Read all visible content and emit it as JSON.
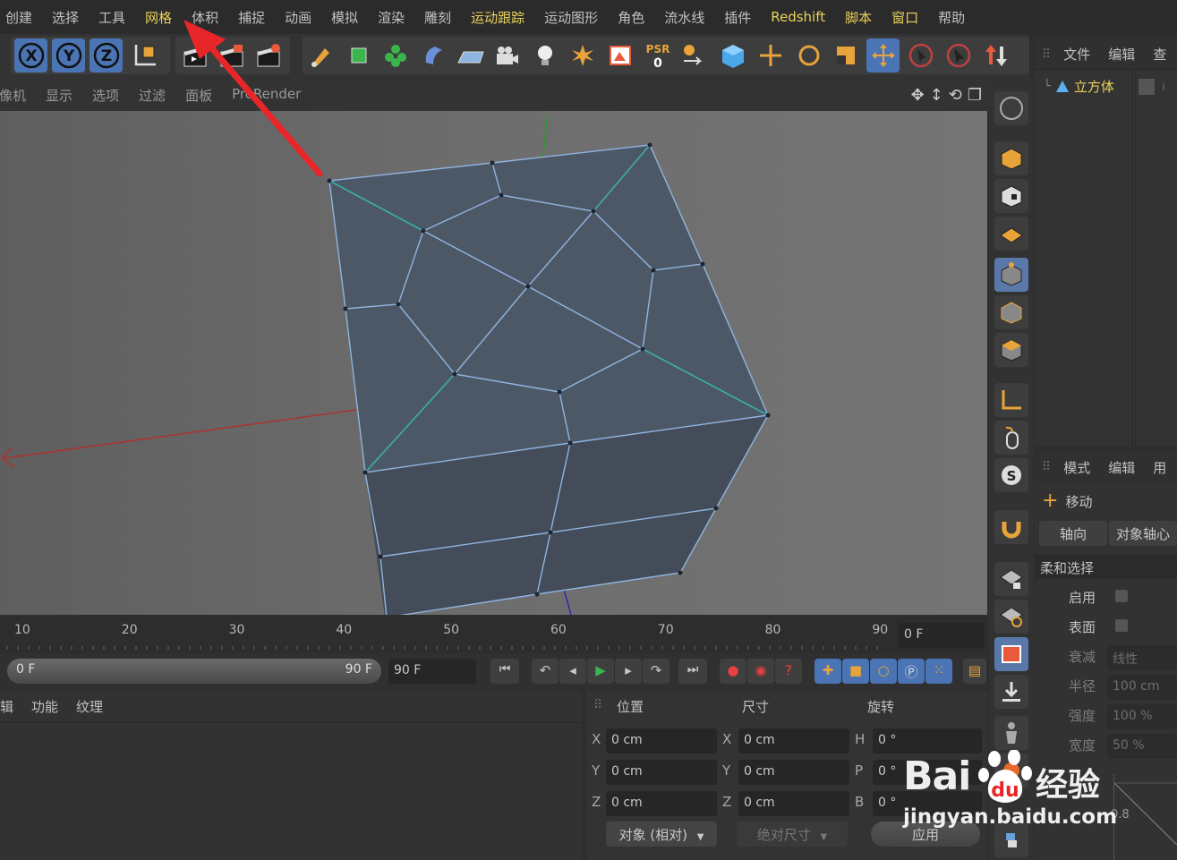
{
  "menubar": {
    "items": [
      "创建",
      "选择",
      "工具",
      "网格",
      "体积",
      "捕捉",
      "动画",
      "模拟",
      "渲染",
      "雕刻",
      "运动跟踪",
      "运动图形",
      "角色",
      "流水线",
      "插件",
      "Redshift",
      "脚本",
      "窗口",
      "帮助"
    ],
    "highlighted": [
      "网格",
      "运动跟踪",
      "Redshift",
      "脚本",
      "窗口"
    ]
  },
  "toolbar": {
    "axis_x": "X",
    "axis_y": "Y",
    "axis_z": "Z",
    "psr_label": "PSR",
    "psr_value": "0"
  },
  "viewport_menu": [
    "像机",
    "显示",
    "选项",
    "过滤",
    "面板",
    "ProRender"
  ],
  "object_manager": {
    "menu": [
      "文件",
      "编辑",
      "查"
    ],
    "object_name": "立方体"
  },
  "attribute_manager": {
    "menu": [
      "模式",
      "编辑",
      "用"
    ],
    "tool_name": "移动",
    "tabs": [
      "轴向",
      "对象轴心"
    ],
    "section": "柔和选择",
    "fields": [
      {
        "label": "启用",
        "value": ""
      },
      {
        "label": "表面",
        "value": ""
      },
      {
        "label": "衰减",
        "value": "线性"
      },
      {
        "label": "半径",
        "value": "100 cm"
      },
      {
        "label": "强度",
        "value": "100 %"
      },
      {
        "label": "宽度",
        "value": "50 %"
      }
    ],
    "graph_value": "0.8"
  },
  "timeline": {
    "ticks": [
      "10",
      "20",
      "30",
      "40",
      "50",
      "60",
      "70",
      "80",
      "90"
    ],
    "current_frame": "0 F",
    "range_start": "0 F",
    "range_end": "90 F",
    "end_frame": "90 F"
  },
  "bottom_tabs": [
    "辑",
    "功能",
    "纹理"
  ],
  "coordinates": {
    "headers": [
      "位置",
      "尺寸",
      "旋转"
    ],
    "rows": [
      {
        "axis": "X",
        "pos": "0 cm",
        "size_axis": "X",
        "size": "0 cm",
        "rot_axis": "H",
        "rot": "0 °"
      },
      {
        "axis": "Y",
        "pos": "0 cm",
        "size_axis": "Y",
        "size": "0 cm",
        "rot_axis": "P",
        "rot": "0 °"
      },
      {
        "axis": "Z",
        "pos": "0 cm",
        "size_axis": "Z",
        "size": "0 cm",
        "rot_axis": "B",
        "rot": "0 °"
      }
    ],
    "mode_select": "对象 (相对)",
    "size_select": "绝对尺寸",
    "apply_button": "应用"
  },
  "watermark": {
    "brand": "Bai",
    "brand2": "经验",
    "url": "jingyan.baidu.com"
  },
  "colors": {
    "accent_blue": "#4b74b5",
    "menu_highlight": "#e8d25a",
    "arrow_red": "#e8262a",
    "mesh_edge": "#8fb4e0"
  }
}
